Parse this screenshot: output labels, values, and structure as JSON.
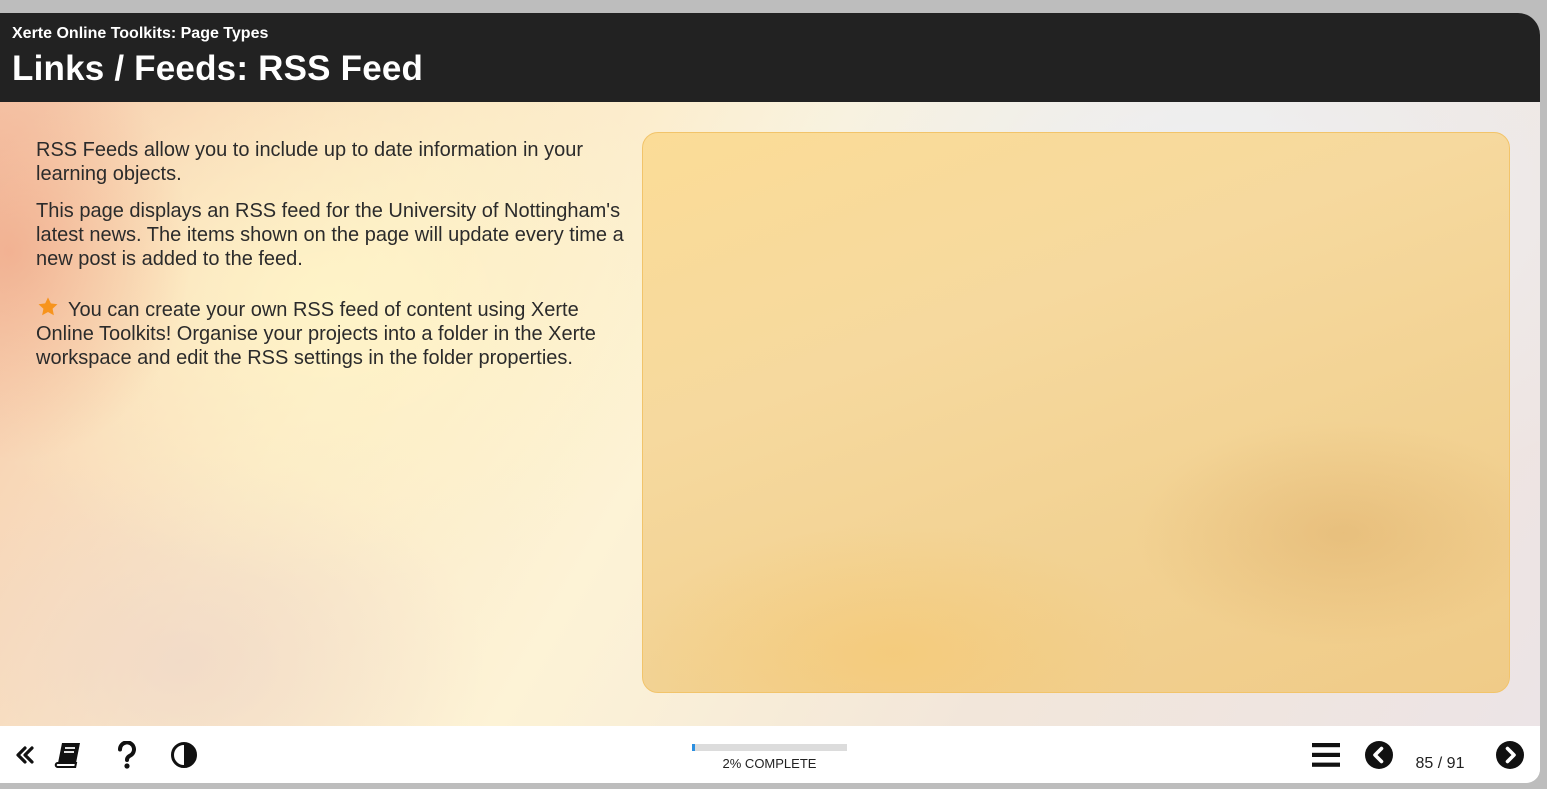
{
  "header": {
    "subtitle": "Xerte Online Toolkits: Page Types",
    "title": "Links / Feeds: RSS Feed"
  },
  "content": {
    "paragraph1": "RSS Feeds allow you to include up to date information in your learning objects.",
    "paragraph2": "This page displays an RSS feed for the University of Nottingham's latest news. The items shown on the page will update every time a new post is added to the feed.",
    "paragraph3": "You can create your own RSS feed of content using Xerte Online Toolkits! Organise your projects into a folder in the Xerte workspace and edit the RSS settings in the folder properties.",
    "tip_icon": "star-icon",
    "tip_icon_color": "#f7941d"
  },
  "footer": {
    "icons": {
      "collapse": "double-chevron-left-icon",
      "glossary": "book-icon",
      "help": "question-mark-icon",
      "contrast": "contrast-icon",
      "menu": "hamburger-menu-icon",
      "previous": "chevron-left-circle-icon",
      "next": "chevron-right-circle-icon"
    },
    "progress": {
      "percent": 2,
      "label": "2% COMPLETE",
      "fill_color": "#2b8fe0"
    },
    "page_counter": "85 / 91"
  },
  "colors": {
    "header_bg": "#222222",
    "panel_border": "#f2c46a"
  }
}
